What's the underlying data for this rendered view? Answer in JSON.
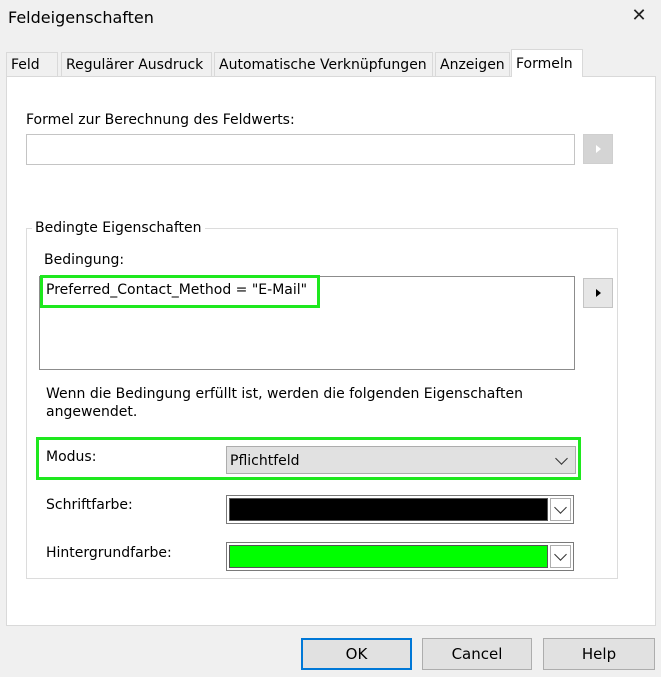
{
  "window": {
    "title": "Feldeigenschaften"
  },
  "tabs": [
    {
      "label": "Feld"
    },
    {
      "label": "Regulärer Ausdruck"
    },
    {
      "label": "Automatische Verknüpfungen"
    },
    {
      "label": "Anzeigen"
    },
    {
      "label": "Formeln",
      "active": true
    }
  ],
  "formula": {
    "label": "Formel zur Berechnung des Feldwerts:",
    "value": ""
  },
  "conditional": {
    "group_title": "Bedingte Eigenschaften",
    "condition_label": "Bedingung:",
    "condition_value": "Preferred_Contact_Method = \"E-Mail\"",
    "info_text": "Wenn die Bedingung erfüllt ist, werden die folgenden Eigenschaften angewendet.",
    "mode_label": "Modus:",
    "mode_value": "Pflichtfeld",
    "font_color_label": "Schriftfarbe:",
    "font_color": "#000000",
    "background_color_label": "Hintergrundfarbe:",
    "background_color": "#00ff00",
    "highlight_color": "#1ee81e"
  },
  "buttons": {
    "ok": "OK",
    "cancel": "Cancel",
    "help": "Help"
  }
}
